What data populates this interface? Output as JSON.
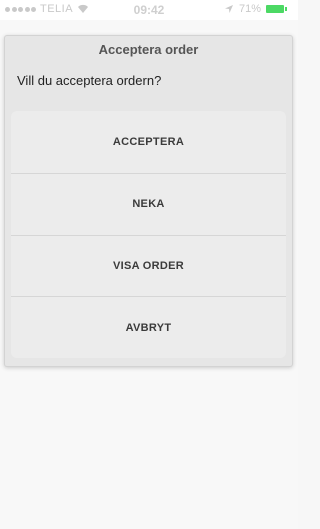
{
  "status_bar": {
    "carrier": "TELIA",
    "time": "09:42",
    "battery": "71%"
  },
  "dialog": {
    "title": "Acceptera order",
    "message": "Vill du acceptera ordern?",
    "options": [
      "ACCEPTERA",
      "NEKA",
      "VISA ORDER",
      "AVBRYT"
    ]
  },
  "colors": {
    "battery": "#4cd964",
    "dialog_bg": "#e6e6e6",
    "option_bg": "#ececec"
  }
}
